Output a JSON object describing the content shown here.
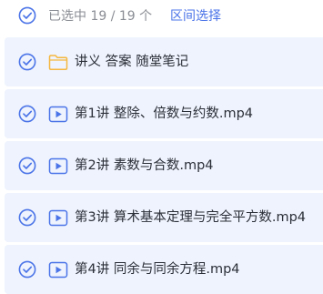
{
  "header": {
    "selection_text": "已选中 19 / 19 个",
    "range_select_label": "区间选择"
  },
  "items": [
    {
      "type": "folder",
      "icon": "folder-icon",
      "label": "讲义 答案  随堂笔记"
    },
    {
      "type": "video",
      "icon": "video-file-icon",
      "label": "第1讲 整除、倍数与约数.mp4"
    },
    {
      "type": "video",
      "icon": "video-file-icon",
      "label": "第2讲 素数与合数.mp4"
    },
    {
      "type": "video",
      "icon": "video-file-icon",
      "label": "第3讲 算术基本定理与完全平方数.mp4"
    },
    {
      "type": "video",
      "icon": "video-file-icon",
      "label": "第4讲 同余与同余方程.mp4"
    }
  ],
  "colors": {
    "accent": "#4b74e8",
    "row_background": "#eef3fd",
    "folder": "#f5b740"
  }
}
